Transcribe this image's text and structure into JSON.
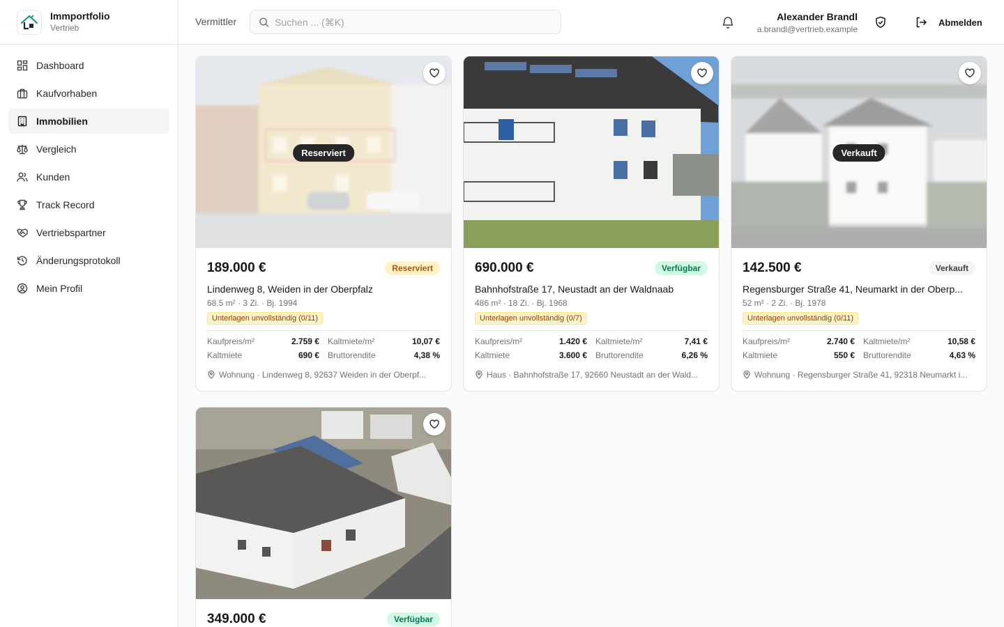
{
  "app": {
    "name": "Immportfolio",
    "subtitle": "Vertrieb"
  },
  "sidebar": {
    "items": [
      {
        "label": "Dashboard",
        "icon": "dashboard-icon"
      },
      {
        "label": "Kaufvorhaben",
        "icon": "briefcase-icon"
      },
      {
        "label": "Immobilien",
        "icon": "building-icon",
        "active": true
      },
      {
        "label": "Vergleich",
        "icon": "scale-icon"
      },
      {
        "label": "Kunden",
        "icon": "users-icon"
      },
      {
        "label": "Track Record",
        "icon": "trophy-icon"
      },
      {
        "label": "Vertriebspartner",
        "icon": "handshake-icon"
      },
      {
        "label": "Änderungsprotokoll",
        "icon": "history-icon"
      },
      {
        "label": "Mein Profil",
        "icon": "user-circle-icon"
      }
    ]
  },
  "header": {
    "role_label": "Vermittler",
    "search_placeholder": "Suchen ... (⌘K)",
    "user_name": "Alexander Brandl",
    "user_email": "a.brandl@vertrieb.example",
    "logout_label": "Abmelden"
  },
  "properties": [
    {
      "price": "189.000 €",
      "status": "Reserviert",
      "overlay": "Reserviert",
      "address": "Lindenweg 8, Weiden in der Oberpfalz",
      "meta": "68,5 m² · 3 Zi. · Bj. 1994",
      "warning": "Unterlagen unvollständig (0/11)",
      "k1": "Kaufpreis/m²",
      "v1": "2.759 €",
      "k2": "Kaltmiete/m²",
      "v2": "10,07 €",
      "k3": "Kaltmiete",
      "v3": "690 €",
      "k4": "Bruttorendite",
      "v4": "4,38 %",
      "location": "Wohnung · Lindenweg 8, 92637 Weiden in der Oberpf..."
    },
    {
      "price": "690.000 €",
      "status": "Verfügbar",
      "address": "Bahnhofstraße 17, Neustadt an der Waldnaab",
      "meta": "486 m² · 18 Zi. · Bj. 1968",
      "warning": "Unterlagen unvollständig (0/7)",
      "k1": "Kaufpreis/m²",
      "v1": "1.420 €",
      "k2": "Kaltmiete/m²",
      "v2": "7,41 €",
      "k3": "Kaltmiete",
      "v3": "3.600 €",
      "k4": "Bruttorendite",
      "v4": "6,26 %",
      "location": "Haus · Bahnhofstraße 17, 92660 Neustadt an der Wald..."
    },
    {
      "price": "142.500 €",
      "status": "Verkauft",
      "overlay": "Verkauft",
      "address": "Regensburger Straße 41, Neumarkt in der Oberp...",
      "meta": "52 m² · 2 Zi. · Bj. 1978",
      "warning": "Unterlagen unvollständig (0/11)",
      "k1": "Kaufpreis/m²",
      "v1": "2.740 €",
      "k2": "Kaltmiete/m²",
      "v2": "10,58 €",
      "k3": "Kaltmiete",
      "v3": "550 €",
      "k4": "Bruttorendite",
      "v4": "4,63 %",
      "location": "Wohnung · Regensburger Straße 41, 92318 Neumarkt i..."
    },
    {
      "price": "349.000 €",
      "status": "Verfügbar"
    }
  ]
}
